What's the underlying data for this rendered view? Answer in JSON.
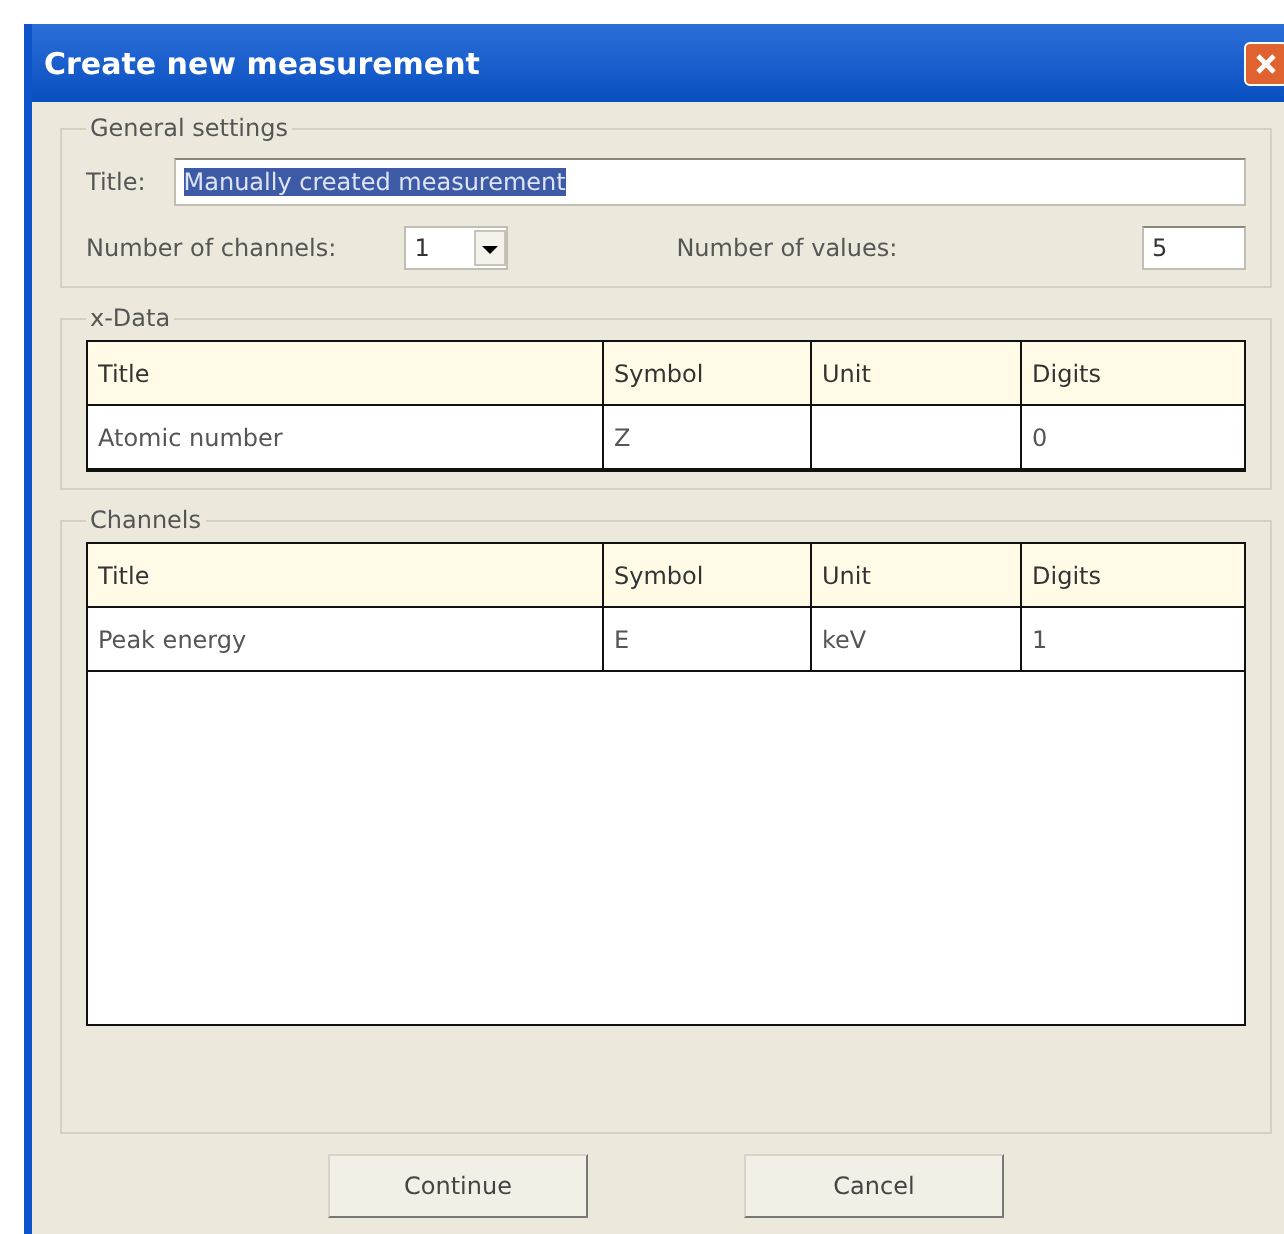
{
  "window": {
    "title": "Create new measurement"
  },
  "general_settings": {
    "legend": "General settings",
    "title_label": "Title:",
    "title_value": "Manually created measurement",
    "title_text_selected": true,
    "channels_label": "Number of channels:",
    "channels_value": "1",
    "values_label": "Number of values:",
    "values_value": "5"
  },
  "x_data": {
    "legend": "x-Data",
    "columns": [
      "Title",
      "Symbol",
      "Unit",
      "Digits"
    ],
    "rows": [
      [
        "Atomic number",
        "Z",
        "",
        "0"
      ]
    ]
  },
  "channels": {
    "legend": "Channels",
    "columns": [
      "Title",
      "Symbol",
      "Unit",
      "Digits"
    ],
    "rows": [
      [
        "Peak energy",
        "E",
        "keV",
        "1"
      ]
    ]
  },
  "buttons": [
    "Continue",
    "Cancel"
  ]
}
